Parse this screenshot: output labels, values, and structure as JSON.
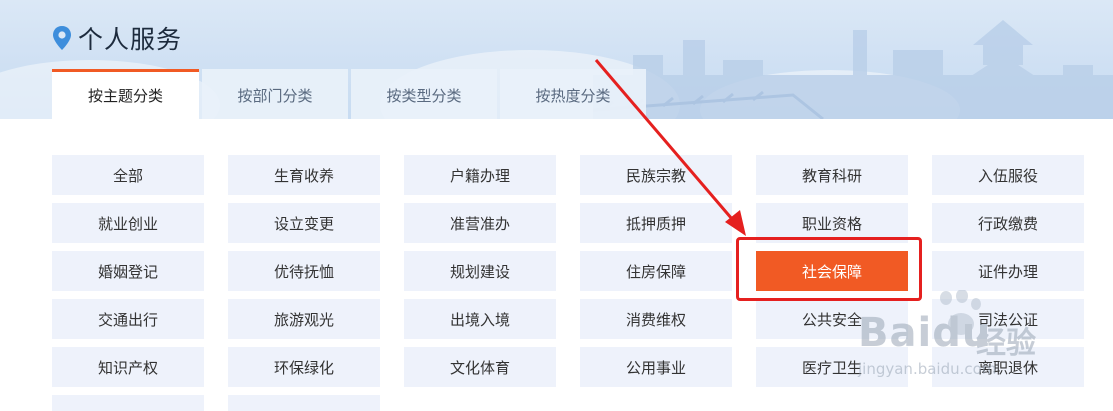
{
  "page": {
    "title": "个人服务"
  },
  "tabs": [
    {
      "label": "按主题分类",
      "active": true
    },
    {
      "label": "按部门分类",
      "active": false
    },
    {
      "label": "按类型分类",
      "active": false
    },
    {
      "label": "按热度分类",
      "active": false
    }
  ],
  "categories": [
    [
      "全部",
      "生育收养",
      "户籍办理",
      "民族宗教",
      "教育科研",
      "入伍服役"
    ],
    [
      "就业创业",
      "设立变更",
      "准营准办",
      "抵押质押",
      "职业资格",
      "行政缴费"
    ],
    [
      "婚姻登记",
      "优待抚恤",
      "规划建设",
      "住房保障",
      "社会保障",
      "证件办理"
    ],
    [
      "交通出行",
      "旅游观光",
      "出境入境",
      "消费维权",
      "公共安全",
      "司法公证"
    ],
    [
      "知识产权",
      "环保绿化",
      "文化体育",
      "公用事业",
      "医疗卫生",
      "离职退休"
    ]
  ],
  "selected_category": "社会保障",
  "colors": {
    "accent": "#f15a24",
    "highlight_box": "#e5201f",
    "cell_bg": "#eef2fb"
  },
  "watermark": {
    "brand": "Baidu",
    "cn": "经验",
    "url": "jingyan.baidu.com"
  }
}
